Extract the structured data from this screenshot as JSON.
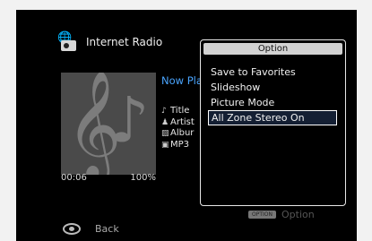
{
  "header": {
    "title": "Internet Radio",
    "icon": "internet-radio-icon"
  },
  "now_playing": {
    "label": "Now Pla",
    "title": "Title",
    "artist": "Artist",
    "album": "Albur",
    "format": "MP3",
    "elapsed": "00:06",
    "buffer": "100%"
  },
  "footer": {
    "back_label": "Back",
    "option_label": "Option",
    "option_key": "OPTION"
  },
  "option_menu": {
    "title": "Option",
    "items": [
      {
        "label": "Save to Favorites"
      },
      {
        "label": "Slideshow"
      },
      {
        "label": "Picture Mode"
      },
      {
        "label": "All Zone Stereo On"
      }
    ],
    "selected_index": 3
  }
}
